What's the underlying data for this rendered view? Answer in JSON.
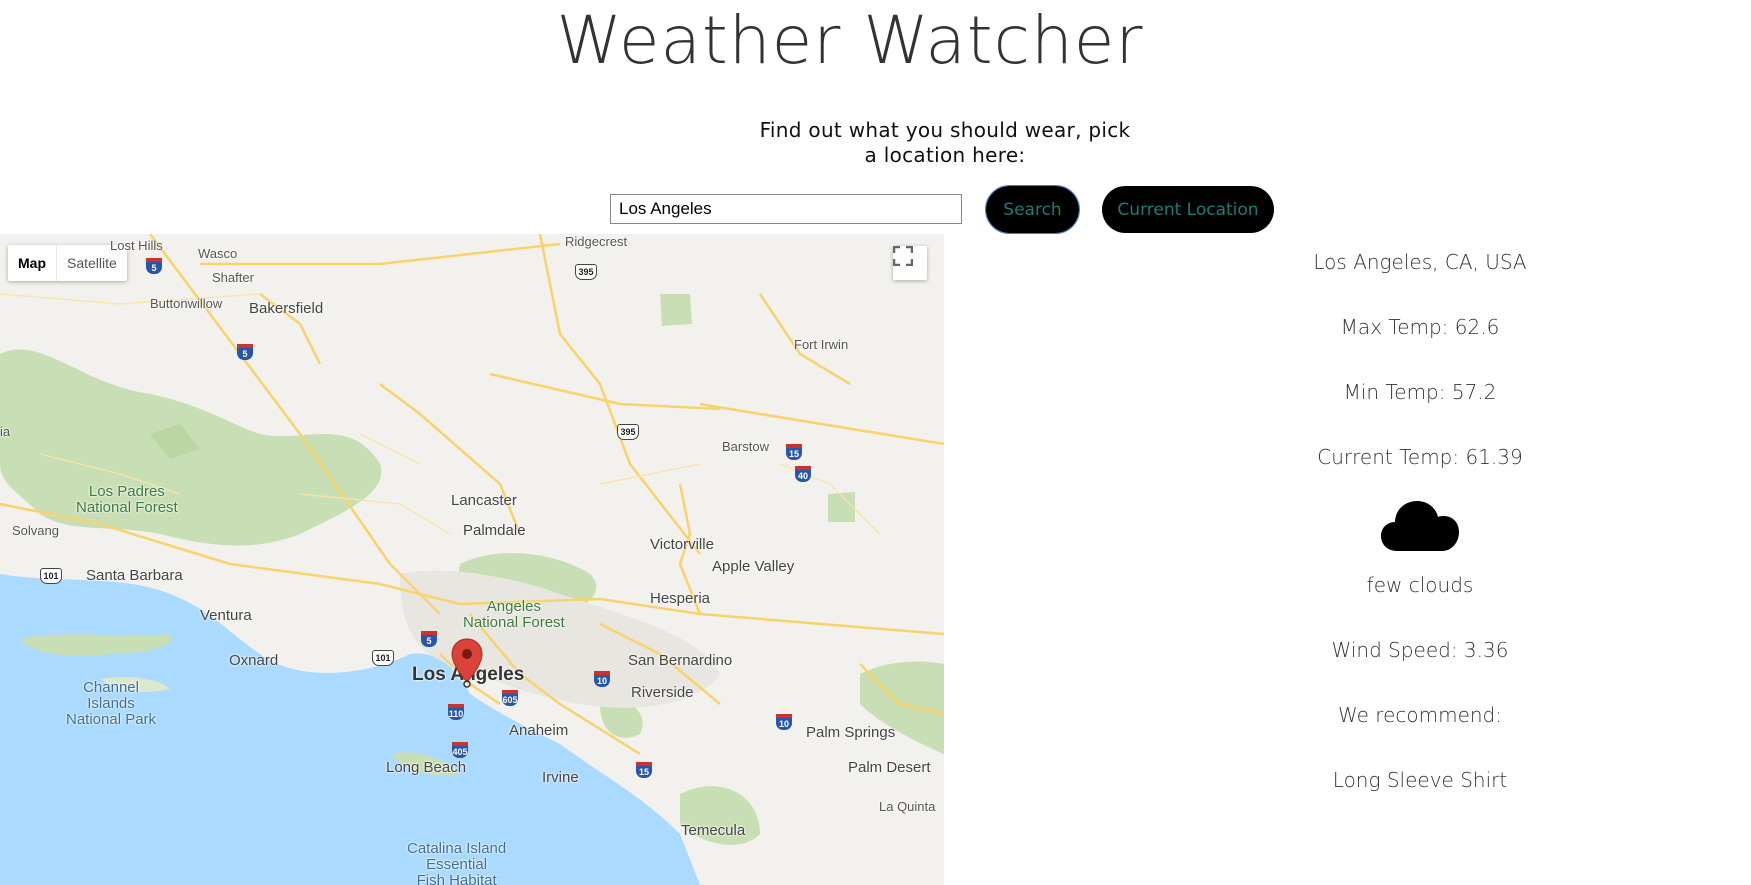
{
  "app": {
    "title": "Weather Watcher",
    "prompt": "Find out what you should wear, pick a location here:"
  },
  "search": {
    "value": "Los Angeles",
    "button_label": "Search",
    "current_location_label": "Current Location"
  },
  "map": {
    "type_controls": [
      "Map",
      "Satellite"
    ],
    "fullscreen_icon": "fullscreen-icon",
    "marker_icon": "map-pin-icon",
    "labels": {
      "lost_hills": "Lost Hills",
      "wasco": "Wasco",
      "shafter": "Shafter",
      "buttonwillow": "Buttonwillow",
      "bakersfield": "Bakersfield",
      "ridgecrest": "Ridgecrest",
      "fort_irwin": "Fort Irwin",
      "barstow": "Barstow",
      "lancaster": "Lancaster",
      "palmdale": "Palmdale",
      "los_padres": "Los Padres\nNational Forest",
      "solvang": "Solvang",
      "santa_barbara": "Santa Barbara",
      "ventura": "Ventura",
      "oxnard": "Oxnard",
      "channel_islands": "Channel\nIslands\nNational Park",
      "victorville": "Victorville",
      "apple_valley": "Apple Valley",
      "hesperia": "Hesperia",
      "angeles_nf": "Angeles\nNational Forest",
      "los_angeles": "Los Angeles",
      "san_bernardino": "San Bernardino",
      "riverside": "Riverside",
      "anaheim": "Anaheim",
      "long_beach": "Long Beach",
      "irvine": "Irvine",
      "palm_springs": "Palm Springs",
      "palm_desert": "Palm Desert",
      "la_quinta": "La Quinta",
      "temecula": "Temecula",
      "catalina": "Catalina Island\nEssential\nFish Habitat",
      "ia": "ia"
    },
    "shields": {
      "i5_a": "5",
      "i5_b": "5",
      "i5_c": "5",
      "us395_a": "395",
      "us395_b": "395",
      "i15_a": "15",
      "i15_b": "15",
      "i40": "40",
      "us101_a": "101",
      "us101_b": "101",
      "i10_a": "10",
      "i10_b": "10",
      "i110": "110",
      "i605": "605",
      "i405": "405"
    }
  },
  "weather": {
    "location": "Los Angeles, CA, USA",
    "max_temp": "Max Temp: 62.6",
    "min_temp": "Min Temp: 57.2",
    "current_temp": "Current Temp: 61.39",
    "icon": "cloud-icon",
    "description": "few clouds",
    "wind_speed": "Wind Speed: 3.36",
    "recommend_label": "We recommend:",
    "recommendation": "Long Sleeve Shirt"
  },
  "colors": {
    "button_bg": "#000000",
    "button_text": "#1f7a7a",
    "map_land": "#f2f1ed",
    "map_water": "#aadaff",
    "map_park": "#c8dfb5",
    "map_road": "#f8d36b",
    "marker": "#d9433a"
  }
}
